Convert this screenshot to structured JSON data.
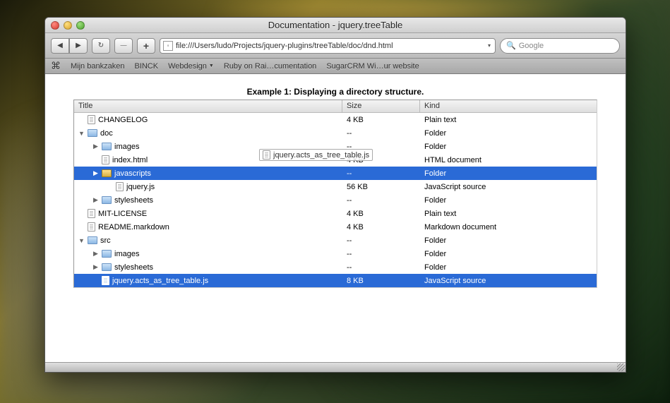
{
  "window": {
    "title": "Documentation - jquery.treeTable"
  },
  "toolbar": {
    "url": "file:///Users/ludo/Projects/jquery-plugins/treeTable/doc/dnd.html",
    "search_placeholder": "Google"
  },
  "bookmarks": [
    "Mijn bankzaken",
    "BINCK",
    "Webdesign",
    "Ruby on Rai…cumentation",
    "SugarCRM Wi…ur website"
  ],
  "example": {
    "caption": "Example 1: Displaying a directory structure."
  },
  "columns": {
    "title": "Title",
    "size": "Size",
    "kind": "Kind"
  },
  "rows": [
    {
      "indent": 0,
      "expander": "",
      "icon": "file",
      "name": "CHANGELOG",
      "size": "4 KB",
      "kind": "Plain text",
      "sel": false
    },
    {
      "indent": 0,
      "expander": "down",
      "icon": "folder",
      "name": "doc",
      "size": "--",
      "kind": "Folder",
      "sel": false
    },
    {
      "indent": 1,
      "expander": "right",
      "icon": "folder",
      "name": "images",
      "size": "--",
      "kind": "Folder",
      "sel": false
    },
    {
      "indent": 1,
      "expander": "",
      "icon": "file",
      "name": "index.html",
      "size": "4 KB",
      "kind": "HTML document",
      "sel": false
    },
    {
      "indent": 1,
      "expander": "right",
      "icon": "folder-open",
      "name": "javascripts",
      "size": "--",
      "kind": "Folder",
      "sel": true
    },
    {
      "indent": 2,
      "expander": "",
      "icon": "file",
      "name": "jquery.js",
      "size": "56 KB",
      "kind": "JavaScript source",
      "sel": false
    },
    {
      "indent": 1,
      "expander": "right",
      "icon": "folder",
      "name": "stylesheets",
      "size": "--",
      "kind": "Folder",
      "sel": false
    },
    {
      "indent": 0,
      "expander": "",
      "icon": "file",
      "name": "MIT-LICENSE",
      "size": "4 KB",
      "kind": "Plain text",
      "sel": false
    },
    {
      "indent": 0,
      "expander": "",
      "icon": "file",
      "name": "README.markdown",
      "size": "4 KB",
      "kind": "Markdown document",
      "sel": false
    },
    {
      "indent": 0,
      "expander": "down",
      "icon": "folder",
      "name": "src",
      "size": "--",
      "kind": "Folder",
      "sel": false
    },
    {
      "indent": 1,
      "expander": "right",
      "icon": "folder",
      "name": "images",
      "size": "--",
      "kind": "Folder",
      "sel": false
    },
    {
      "indent": 1,
      "expander": "right",
      "icon": "folder",
      "name": "stylesheets",
      "size": "--",
      "kind": "Folder",
      "sel": false
    },
    {
      "indent": 1,
      "expander": "",
      "icon": "file",
      "name": "jquery.acts_as_tree_table.js",
      "size": "8 KB",
      "kind": "JavaScript source",
      "sel": true
    }
  ],
  "drag": {
    "label": "jquery.acts_as_tree_table.js"
  }
}
